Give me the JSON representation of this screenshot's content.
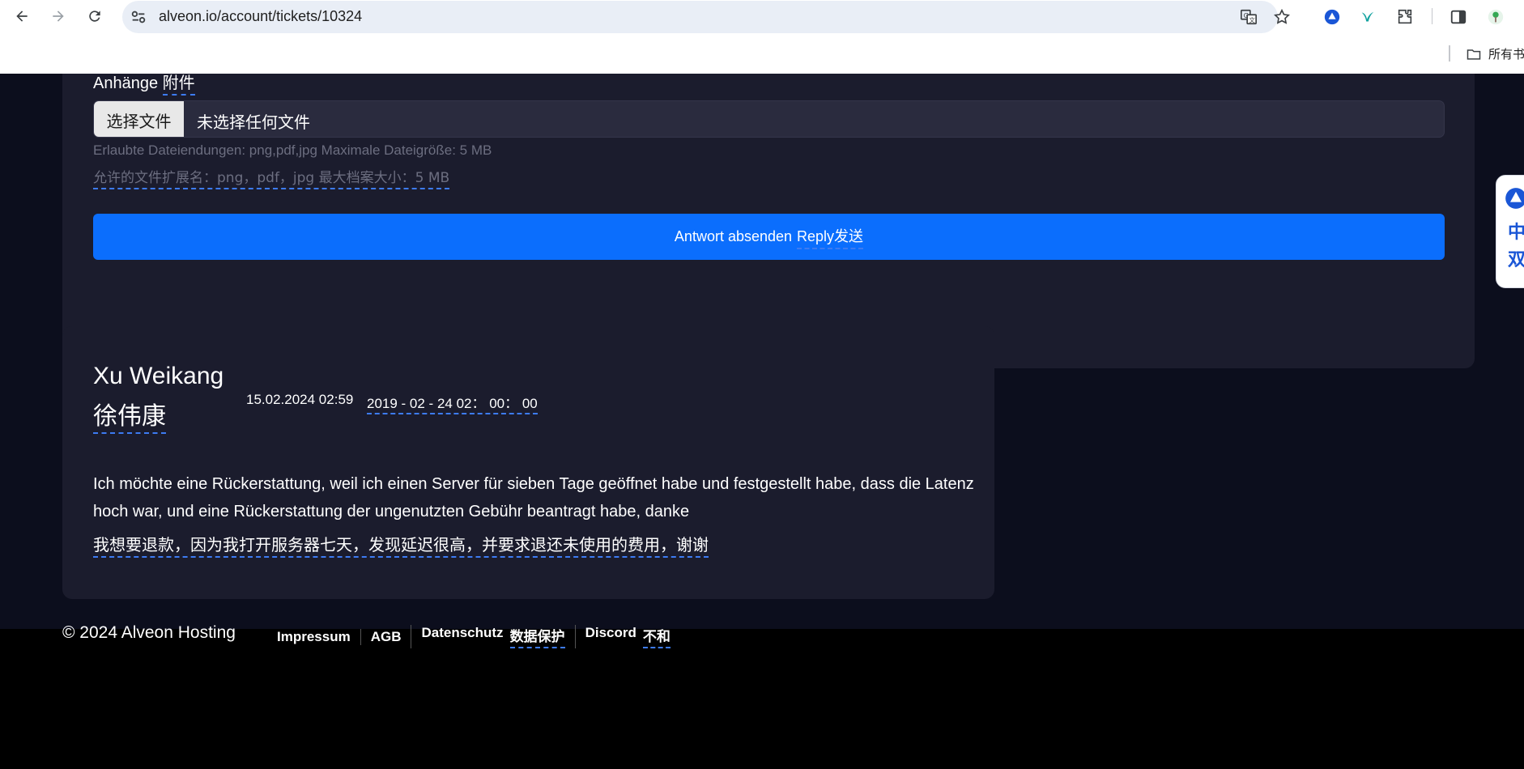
{
  "browser": {
    "url": "alveon.io/account/tickets/10324",
    "bookmarks_folder_label": "所有书"
  },
  "reply_form": {
    "attachments_label_de": "Anhänge",
    "attachments_label_zh": "附件",
    "file_button_label": "选择文件",
    "file_status": "未选择任何文件",
    "hint_de": "Erlaubte Dateiendungen: png,pdf,jpg Maximale Dateigröße: 5 MB",
    "hint_zh": "允许的文件扩展名：png，pdf，jpg 最大档案大小：5 MB",
    "submit_label_de": "Antwort absenden",
    "submit_label_zh": "Reply发送"
  },
  "translate_sidebar": {
    "line1": "中",
    "line2": "双"
  },
  "message": {
    "author_en": "Xu Weikang",
    "author_zh": "徐伟康",
    "date": "15.02.2024 02:59",
    "date_zh": "2019 - 02 - 24 02： 00： 00",
    "body_de": "Ich möchte eine Rückerstattung, weil ich einen Server für sieben Tage geöffnet habe und festgestellt habe, dass die Latenz hoch war, und eine Rückerstattung der ungenutzten Gebühr beantragt habe, danke",
    "body_zh": "我想要退款，因为我打开服务器七天，发现延迟很高，并要求退还未使用的费用，谢谢"
  },
  "footer": {
    "copyright": "© 2024 Alveon Hosting",
    "links": [
      {
        "label": "Impressum",
        "zh": ""
      },
      {
        "label": "AGB",
        "zh": ""
      },
      {
        "label": "Datenschutz",
        "zh": "数据保护"
      },
      {
        "label": "Discord",
        "zh": "不和"
      }
    ]
  },
  "colors": {
    "page_bg": "#0c0e1d",
    "card_bg": "#1b1c2d",
    "primary": "#0b6efd",
    "dashed_underline": "#3d7bf2",
    "footer_bg": "#000000"
  },
  "icons": [
    "back-arrow-icon",
    "forward-arrow-icon",
    "reload-icon",
    "site-info-icon",
    "translate-icon",
    "star-icon",
    "extension-icon",
    "side-panel-icon",
    "folder-icon"
  ]
}
